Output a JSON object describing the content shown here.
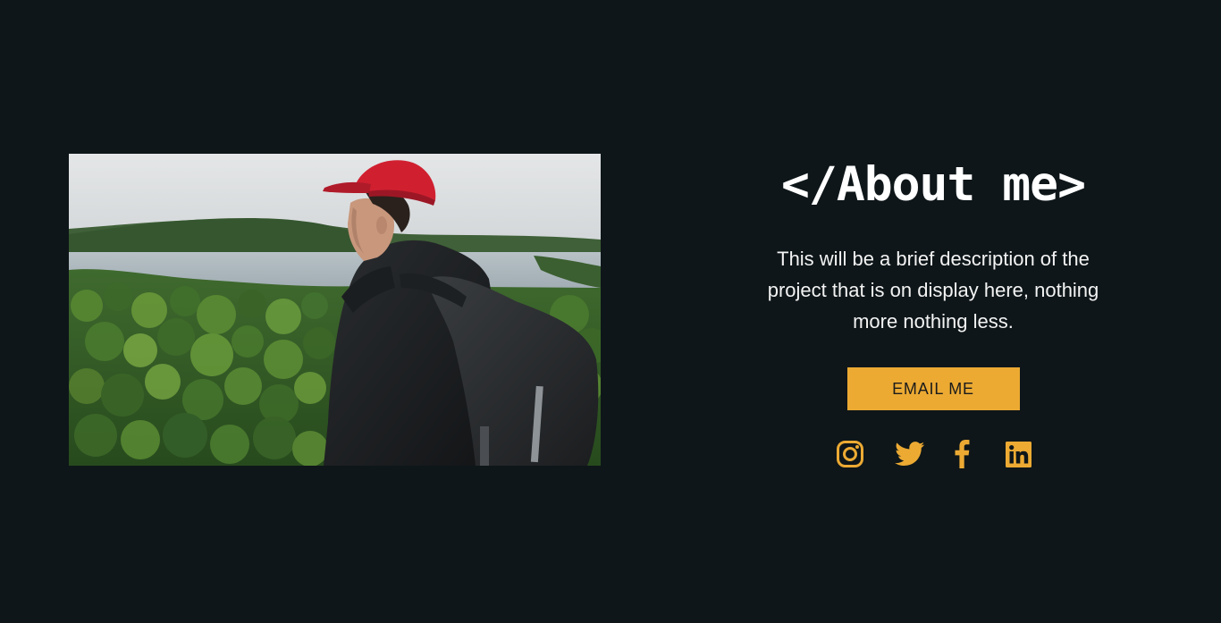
{
  "photo": {
    "alt": "Hiker with red cap and black backpack overlooking a forested lake"
  },
  "about": {
    "title": "</About me>",
    "description": "This will be a brief description of the project that is on display here, nothing more nothing less.",
    "email_button_label": "EMAIL ME"
  },
  "socials": [
    {
      "name": "Instagram",
      "icon": "instagram-icon"
    },
    {
      "name": "Twitter",
      "icon": "twitter-icon"
    },
    {
      "name": "Facebook",
      "icon": "facebook-icon"
    },
    {
      "name": "LinkedIn",
      "icon": "linkedin-icon"
    }
  ],
  "colors": {
    "background": "#0e1619",
    "accent": "#ecaa33",
    "text": "#ffffff"
  }
}
